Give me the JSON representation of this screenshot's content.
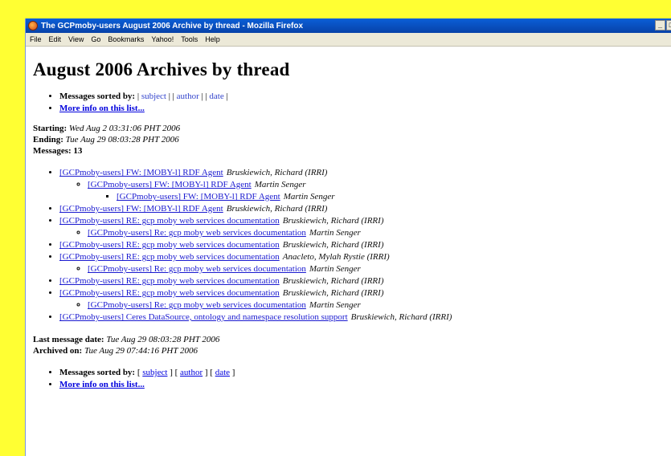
{
  "window": {
    "title": "The GCPmoby-users August 2006 Archive by thread - Mozilla Firefox",
    "controls": [
      "_",
      "□"
    ]
  },
  "menu": [
    "File",
    "Edit",
    "View",
    "Go",
    "Bookmarks",
    "Yahoo!",
    "Tools",
    "Help"
  ],
  "page": {
    "heading": "August 2006 Archives by thread",
    "sort_label": "Messages sorted by:",
    "sort_links": [
      "subject",
      "author",
      "date"
    ],
    "more_info": "More info on this list...",
    "starting_label": "Starting:",
    "starting_value": "Wed Aug 2 03:31:06 PHT 2006",
    "ending_label": "Ending:",
    "ending_value": "Tue Aug 29 08:03:28 PHT 2006",
    "messages_label": "Messages:",
    "messages_value": "13"
  },
  "threads": [
    {
      "subject": "[GCPmoby-users] FW: [MOBY-l] RDF Agent",
      "author": "Bruskiewich, Richard (IRRI)",
      "level": 0
    },
    {
      "subject": "[GCPmoby-users] FW: [MOBY-l] RDF Agent",
      "author": "Martin Senger",
      "level": 1
    },
    {
      "subject": "[GCPmoby-users] FW: [MOBY-l] RDF Agent",
      "author": "Martin Senger",
      "level": 2
    },
    {
      "subject": "[GCPmoby-users] FW: [MOBY-l] RDF Agent",
      "author": "Bruskiewich, Richard (IRRI)",
      "level": 0
    },
    {
      "subject": "[GCPmoby-users] RE: gcp moby web services documentation",
      "author": "Bruskiewich, Richard (IRRI)",
      "level": 0
    },
    {
      "subject": "[GCPmoby-users] Re: gcp moby web services documentation",
      "author": "Martin Senger",
      "level": 1
    },
    {
      "subject": "[GCPmoby-users] RE: gcp moby web services documentation",
      "author": "Bruskiewich, Richard (IRRI)",
      "level": 0
    },
    {
      "subject": "[GCPmoby-users] RE: gcp moby web services documentation",
      "author": "Anacleto, Mylah Rystie (IRRI)",
      "level": 0
    },
    {
      "subject": "[GCPmoby-users] Re: gcp moby web services documentation",
      "author": "Martin Senger",
      "level": 1
    },
    {
      "subject": "[GCPmoby-users] RE: gcp moby web services documentation",
      "author": "Bruskiewich, Richard (IRRI)",
      "level": 0
    },
    {
      "subject": "[GCPmoby-users] RE: gcp moby web services documentation",
      "author": "Bruskiewich, Richard (IRRI)",
      "level": 0
    },
    {
      "subject": "[GCPmoby-users] Re: gcp moby web services documentation",
      "author": "Martin Senger",
      "level": 1
    },
    {
      "subject": "[GCPmoby-users] Ceres DataSource, ontology and namespace resolution support",
      "author": "Bruskiewich, Richard (IRRI)",
      "level": 0
    }
  ],
  "footer": {
    "last_date_label": "Last message date:",
    "last_date_value": "Tue Aug 29 08:03:28 PHT 2006",
    "archived_label": "Archived on:",
    "archived_value": "Tue Aug 29 07:44:16 PHT 2006",
    "sort_label": "Messages sorted by:",
    "sort_links": [
      "subject",
      "author",
      "date"
    ],
    "more_info": "More info on this list..."
  }
}
